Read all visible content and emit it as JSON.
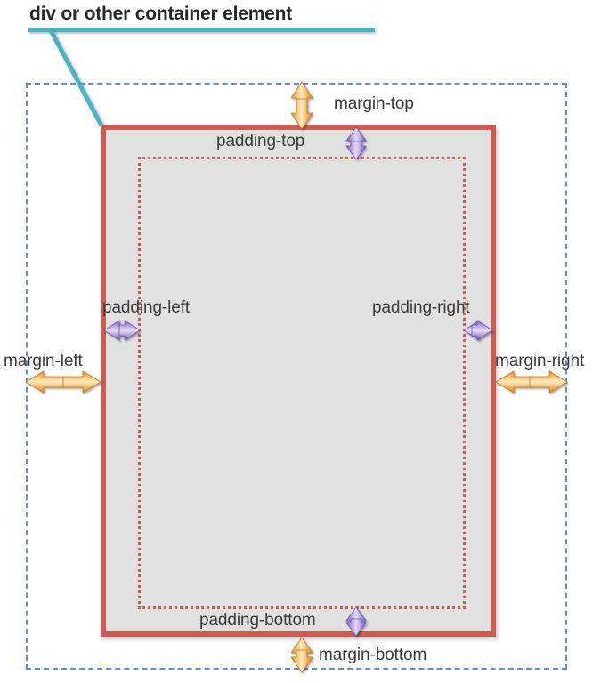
{
  "diagram": {
    "title": "div or other container element",
    "labels": {
      "margin_top": "margin-top",
      "margin_right": "margin-right",
      "margin_bottom": "margin-bottom",
      "margin_left": "margin-left",
      "padding_top": "padding-top",
      "padding_right": "padding-right",
      "padding_bottom": "padding-bottom",
      "padding_left": "padding-left"
    },
    "colors": {
      "title_text": "#262626",
      "callout_line": "#4bb3c4",
      "margin_boundary": "#5b8def",
      "border_box": "#cb5c54",
      "content_fill": "#e1e1e1",
      "padding_boundary": "#cb5c54",
      "margin_arrow": "#e8a33d",
      "padding_arrow": "#9b7fd4",
      "label_text": "#3a3a3a"
    },
    "regions": {
      "margin_box": "margin-boundary-dashed-blue",
      "border_box": "element-border-solid-red",
      "padding_box": "padding-boundary-dotted-red"
    }
  }
}
